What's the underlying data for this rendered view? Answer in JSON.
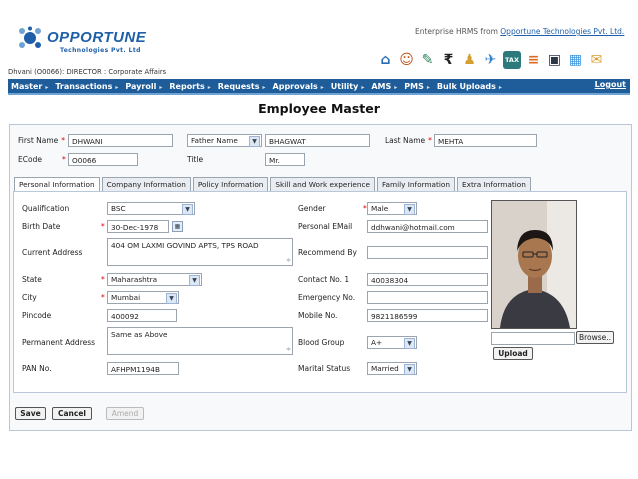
{
  "header": {
    "brand": "OPPORTUNE",
    "brand_sub": "Technologies Pvt. Ltd",
    "tagline_prefix": "Enterprise HRMS from ",
    "tagline_link": "Opportune Technologies Pvt. Ltd.",
    "user_line": "Dhvani (O0066): DIRECTOR : Corporate Affairs",
    "icons": [
      {
        "name": "home-icon",
        "glyph": "⌂",
        "color": "#2b6cb0"
      },
      {
        "name": "users-icon",
        "glyph": "☺",
        "color": "#c05621"
      },
      {
        "name": "notes-icon",
        "glyph": "✎",
        "color": "#2f855a"
      },
      {
        "name": "rupee-icon",
        "glyph": "₹",
        "color": "#ffffff"
      },
      {
        "name": "people-icon",
        "glyph": "♟",
        "color": "#d69e2e"
      },
      {
        "name": "plane-icon",
        "glyph": "✈",
        "color": "#3182ce"
      },
      {
        "name": "tax-icon",
        "glyph": "TAX",
        "color": "#2c7a7b"
      },
      {
        "name": "calculator-icon",
        "glyph": "≡",
        "color": "#dd6b20"
      },
      {
        "name": "case-icon",
        "glyph": "▣",
        "color": "#2d3748"
      },
      {
        "name": "calendar-icon",
        "glyph": "▦",
        "color": "#4299e1"
      },
      {
        "name": "mail-icon",
        "glyph": "✉",
        "color": "#d69e2e"
      }
    ]
  },
  "nav": {
    "items": [
      "Master",
      "Transactions",
      "Payroll",
      "Reports",
      "Requests",
      "Approvals",
      "Utility",
      "AMS",
      "PMS",
      "Bulk Uploads"
    ],
    "logout": "Logout"
  },
  "page_title": "Employee Master",
  "top_fields": {
    "first_name_label": "First Name",
    "first_name_value": "DHWANI",
    "father_name_select": "Father Name",
    "father_name_value": "BHAGWAT",
    "last_name_label": "Last Name",
    "last_name_value": "MEHTA",
    "ecode_label": "ECode",
    "ecode_value": "O0066",
    "title_label": "Title",
    "title_value": "Mr.",
    "required_mark": "*"
  },
  "tabs": [
    "Personal Information",
    "Company Information",
    "Policy Information",
    "Skill and Work experience",
    "Family Information",
    "Extra Information"
  ],
  "personal": {
    "qualification_label": "Qualification",
    "qualification_value": "BSC",
    "birth_date_label": "Birth Date",
    "birth_date_value": "30-Dec-1978",
    "current_address_label": "Current Address",
    "current_address_value": "404 OM LAXMI GOVIND APTS, TPS ROAD",
    "state_label": "State",
    "state_value": "Maharashtra",
    "city_label": "City",
    "city_value": "Mumbai",
    "pincode_label": "Pincode",
    "pincode_value": "400092",
    "permanent_address_label": "Permanent Address",
    "permanent_address_value": "Same as Above",
    "pan_label": "PAN No.",
    "pan_value": "AFHPM1194B",
    "gender_label": "Gender",
    "gender_value": "Male",
    "email_label": "Personal EMail",
    "email_value": "ddhwani@hotmail.com",
    "recommend_label": "Recommend By",
    "recommend_value": "",
    "contact_label": "Contact No. 1",
    "contact_value": "40038304",
    "emergency_label": "Emergency No.",
    "emergency_value": "",
    "mobile_label": "Mobile No.",
    "mobile_value": "9821186599",
    "blood_label": "Blood Group",
    "blood_value": "A+",
    "marital_label": "Marital Status",
    "marital_value": "Married",
    "browse_label": "Browse..",
    "upload_label": "Upload"
  },
  "actions": {
    "save": "Save",
    "cancel": "Cancel",
    "amend": "Amend"
  }
}
